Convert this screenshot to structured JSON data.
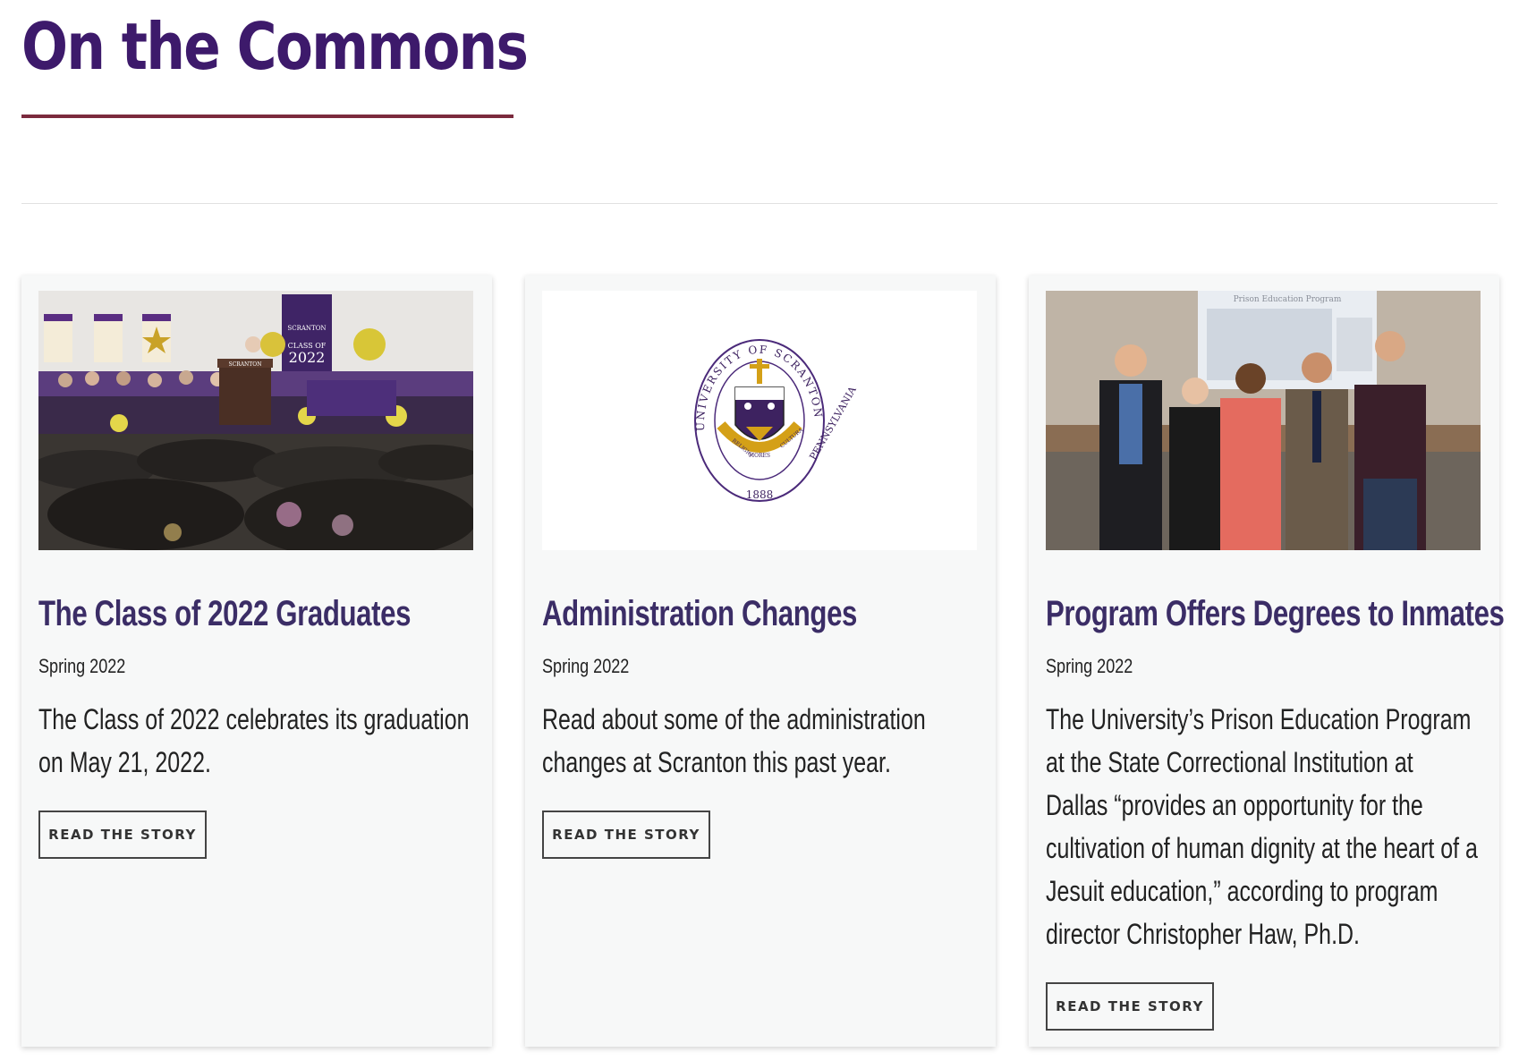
{
  "section": {
    "title": "On the Commons"
  },
  "cards": [
    {
      "title": "The Class of 2022 Graduates",
      "date": "Spring 2022",
      "description": "The Class of 2022 celebrates its graduation on May 21, 2022.",
      "button_label": "READ THE STORY",
      "image_text": {
        "banner_line1": "SCRANTON",
        "banner_line2": "CLASS OF",
        "banner_year": "2022",
        "podium": "SCRANTON"
      }
    },
    {
      "title": "Administration Changes",
      "date": "Spring 2022",
      "description": "Read about some of the administration changes at Scranton this past year.",
      "button_label": "READ THE STORY",
      "image_text": {
        "seal_ring_top": "UNIVERSITY OF SCRANTON",
        "seal_ring_right": "PENNSYLVANIA",
        "seal_year": "1888",
        "motto_1": "RELIGIO",
        "motto_2": "MORES",
        "motto_3": "CULTURA"
      }
    },
    {
      "title": "Program Offers Degrees to Inmates",
      "date": "Spring 2022",
      "description": "The University’s Prison Education Program at the State Correctional Institution at Dallas “provides an opportunity for the cultivation of human dignity at the heart of a Jesuit education,” according to program director Christopher Haw, Ph.D.",
      "button_label": "READ THE STORY",
      "image_text": {
        "screen_title": "Prison Education Program"
      }
    }
  ],
  "colors": {
    "title": "#3d1a6b",
    "underline": "#7b2a3d",
    "card_title": "#3b2d66",
    "card_bg": "#f7f8f8",
    "purple": "#4b2a7a",
    "gold": "#d4a017"
  },
  "icons": [
    "commencement-photo",
    "university-seal",
    "group-photo"
  ]
}
